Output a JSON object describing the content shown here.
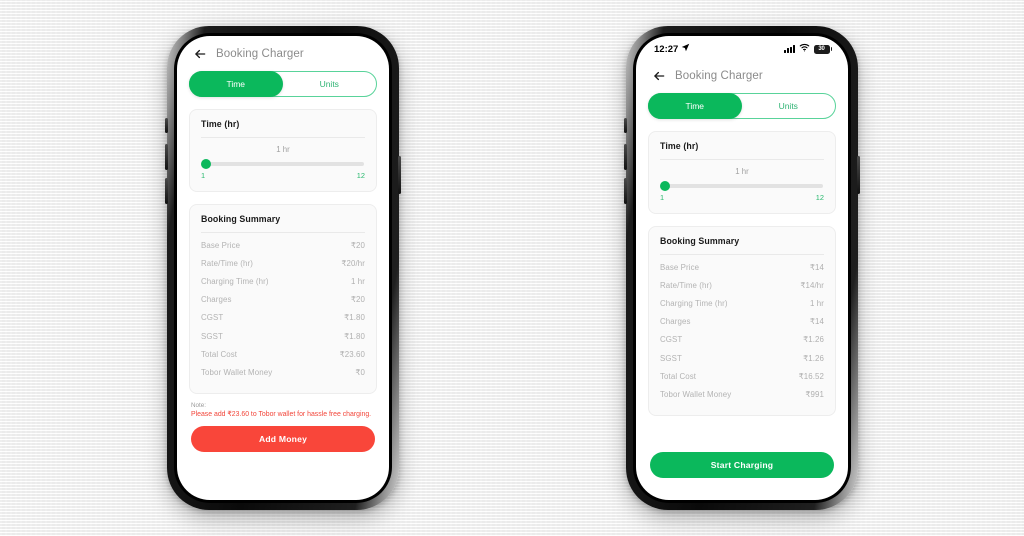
{
  "background": {
    "color": "#f1f1f1"
  },
  "theme": {
    "green": "#0bb85c",
    "green_outline": "#59d39a",
    "red": "#f9463a",
    "muted_text": "#b3b3b3",
    "title_text": "#8b8b8b"
  },
  "phones": [
    {
      "id": "phone-left",
      "has_status_bar": false,
      "appbar": {
        "back_icon": "back-arrow-icon",
        "title": "Booking Charger"
      },
      "tabs": [
        {
          "label": "Time",
          "active": true
        },
        {
          "label": "Units",
          "active": false
        }
      ],
      "time_card": {
        "title": "Time (hr)",
        "value_label": "1 hr",
        "slider": {
          "min_label": "1",
          "max_label": "12",
          "position_percent": 0
        }
      },
      "summary": {
        "title": "Booking Summary",
        "rows": [
          {
            "label": "Base Price",
            "value": "₹20"
          },
          {
            "label": "Rate/Time (hr)",
            "value": "₹20/hr"
          },
          {
            "label": "Charging Time (hr)",
            "value": "1 hr"
          },
          {
            "label": "Charges",
            "value": "₹20"
          },
          {
            "label": "CGST",
            "value": "₹1.80"
          },
          {
            "label": "SGST",
            "value": "₹1.80"
          },
          {
            "label": "Total Cost",
            "value": "₹23.60"
          },
          {
            "label": "Tobor Wallet Money",
            "value": "₹0"
          }
        ]
      },
      "note": {
        "label": "Note:",
        "text": "Please add ₹23.60 to Tobor wallet for hassle free charging."
      },
      "cta": {
        "label": "Add Money",
        "style": "red"
      }
    },
    {
      "id": "phone-right",
      "has_status_bar": true,
      "status_bar": {
        "time": "12:27",
        "location_icon": "location-arrow-icon",
        "signal_icon": "cellular-signal-icon",
        "wifi_icon": "wifi-icon",
        "battery_icon": "battery-icon",
        "battery_level": "30"
      },
      "appbar": {
        "back_icon": "back-arrow-icon",
        "title": "Booking Charger"
      },
      "tabs": [
        {
          "label": "Time",
          "active": true
        },
        {
          "label": "Units",
          "active": false
        }
      ],
      "time_card": {
        "title": "Time (hr)",
        "value_label": "1 hr",
        "slider": {
          "min_label": "1",
          "max_label": "12",
          "position_percent": 0
        }
      },
      "summary": {
        "title": "Booking Summary",
        "rows": [
          {
            "label": "Base Price",
            "value": "₹14"
          },
          {
            "label": "Rate/Time (hr)",
            "value": "₹14/hr"
          },
          {
            "label": "Charging Time (hr)",
            "value": "1 hr"
          },
          {
            "label": "Charges",
            "value": "₹14"
          },
          {
            "label": "CGST",
            "value": "₹1.26"
          },
          {
            "label": "SGST",
            "value": "₹1.26"
          },
          {
            "label": "Total Cost",
            "value": "₹16.52"
          },
          {
            "label": "Tobor Wallet Money",
            "value": "₹991"
          }
        ]
      },
      "note": null,
      "cta": {
        "label": "Start Charging",
        "style": "green"
      }
    }
  ]
}
